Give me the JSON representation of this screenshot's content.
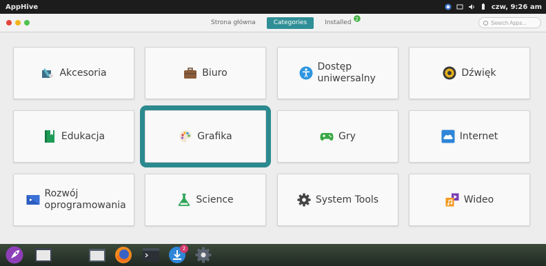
{
  "top_panel": {
    "app_name": "AppHive",
    "clock": "czw, 9:26 am",
    "tray_icons": [
      "network-icon",
      "display-icon",
      "volume-icon",
      "battery-icon"
    ]
  },
  "window": {
    "controls": [
      "close",
      "minimize",
      "maximize"
    ],
    "tabs": [
      {
        "label": "Strona główna",
        "active": false
      },
      {
        "label": "Categories",
        "active": true
      },
      {
        "label": "Installed",
        "active": false,
        "badge": "2"
      }
    ],
    "search_placeholder": "Search Apps...",
    "accent_color": "#2b8a8f"
  },
  "categories": [
    {
      "label": "Akcesoria",
      "icon": "accessories-icon"
    },
    {
      "label": "Biuro",
      "icon": "briefcase-icon"
    },
    {
      "label": "Dostęp uniwersalny",
      "icon": "accessibility-icon"
    },
    {
      "label": "Dźwięk",
      "icon": "speaker-icon"
    },
    {
      "label": "Edukacja",
      "icon": "book-icon"
    },
    {
      "label": "Grafika",
      "icon": "palette-icon",
      "selected": true
    },
    {
      "label": "Gry",
      "icon": "gamepad-icon"
    },
    {
      "label": "Internet",
      "icon": "cloud-icon"
    },
    {
      "label": "Rozwój oprogramowania",
      "icon": "code-icon"
    },
    {
      "label": "Science",
      "icon": "flask-icon"
    },
    {
      "label": "System Tools",
      "icon": "gear-icon"
    },
    {
      "label": "Wideo",
      "icon": "video-icon"
    }
  ],
  "dock": {
    "items": [
      {
        "name": "launcher-icon"
      },
      {
        "name": "files-icon"
      },
      {
        "name": "folder-icon"
      },
      {
        "name": "firefox-icon"
      },
      {
        "name": "terminal-icon"
      },
      {
        "name": "appcenter-icon",
        "badge": "2"
      },
      {
        "name": "settings-icon"
      }
    ]
  }
}
